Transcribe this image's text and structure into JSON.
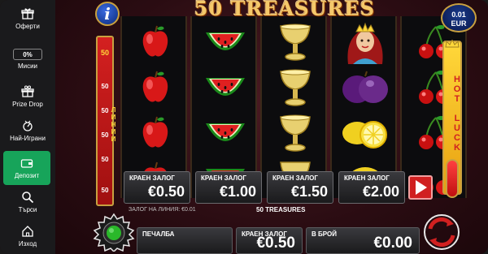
{
  "sidebar": {
    "items": [
      {
        "label": "Оферти",
        "icon": "gift-icon"
      },
      {
        "label": "Мисии",
        "icon": "percent-badge",
        "badge": "0%"
      },
      {
        "label": "Prize Drop",
        "icon": "prize-drop-icon"
      },
      {
        "label": "Най-Играни",
        "icon": "fire-icon"
      },
      {
        "label": "Депозит",
        "icon": "wallet-icon"
      },
      {
        "label": "Търси",
        "icon": "search-icon"
      },
      {
        "label": "Изход",
        "icon": "home-icon"
      }
    ]
  },
  "game": {
    "title": "50 TREASURES",
    "info_label": "i",
    "bet_display": {
      "amount": "0.01",
      "currency": "EUR"
    },
    "lines": {
      "max": "50",
      "label": "ЛИНИИ",
      "markers": [
        "50",
        "50",
        "50",
        "50",
        "50",
        "50"
      ]
    },
    "hotluck_label": "HOT LUCK",
    "reels": [
      [
        "apple",
        "apple",
        "apple",
        "apple"
      ],
      [
        "watermelon",
        "watermelon",
        "watermelon",
        "watermelon"
      ],
      [
        "goblet",
        "goblet",
        "goblet",
        "goblet"
      ],
      [
        "queen",
        "plum",
        "lemon",
        "lemon"
      ],
      [
        "cherries",
        "cherries",
        "cherries",
        "cherries"
      ]
    ],
    "bet_options": [
      {
        "label": "КРАЕН ЗАЛОГ",
        "value": "€0.50"
      },
      {
        "label": "КРАЕН ЗАЛОГ",
        "value": "€1.00"
      },
      {
        "label": "КРАЕН ЗАЛОГ",
        "value": "€1.50"
      },
      {
        "label": "КРАЕН ЗАЛОГ",
        "value": "€2.00"
      }
    ],
    "line_bet_text": "ЗАЛОГ НА ЛИНИЯ: €0.01",
    "game_name": "50 TREASURES",
    "bottom": {
      "win_label": "ПЕЧАЛБА",
      "win_value": "",
      "total_bet_label": "КРАЕН ЗАЛОГ",
      "total_bet_value": "€0.50",
      "cash_label": "В БРОЙ",
      "cash_value": "€0.00"
    }
  },
  "colors": {
    "deposit_green": "#17a45a",
    "lines_red": "#d42020",
    "gold": "#c8a040",
    "spin_green": "#2ab82a"
  }
}
